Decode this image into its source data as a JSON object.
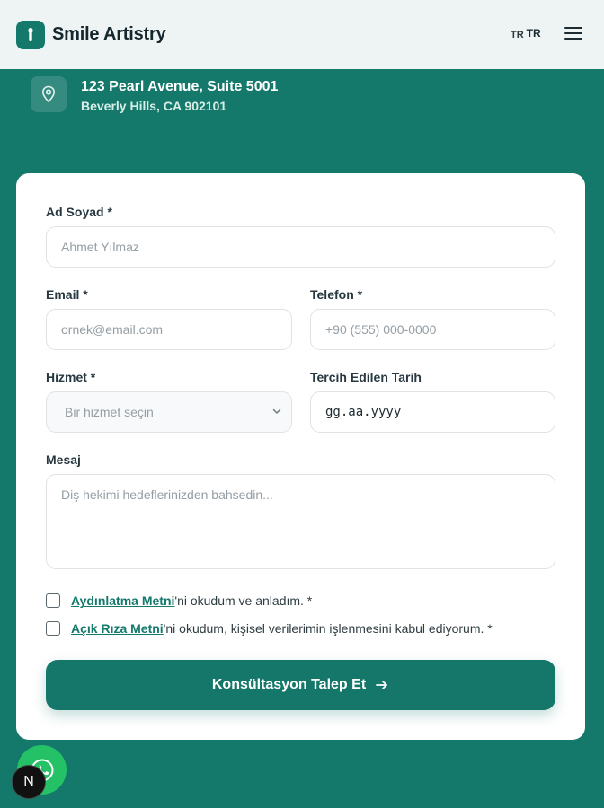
{
  "header": {
    "brand": "Smile Artistry",
    "lang_small": "TR",
    "lang_big": "TR"
  },
  "address": {
    "line1": "123 Pearl Avenue, Suite 5001",
    "line2": "Beverly Hills, CA 902101"
  },
  "form": {
    "name_label": "Ad Soyad *",
    "name_placeholder": "Ahmet Yılmaz",
    "email_label": "Email *",
    "email_placeholder": "ornek@email.com",
    "phone_label": "Telefon *",
    "phone_placeholder": "+90 (555) 000-0000",
    "service_label": "Hizmet *",
    "service_selected": "Bir hizmet seçin",
    "date_label": "Tercih Edilen Tarih",
    "date_value": "gg.aa.yyyy",
    "message_label": "Mesaj",
    "message_placeholder": "Diş hekimi hedeflerinizden bahsedin...",
    "consent1_link": "Aydınlatma Metni",
    "consent1_text": "'ni okudum ve anladım. *",
    "consent2_link": "Açık Rıza Metni",
    "consent2_text": "'ni okudum, kişisel verilerimin işlenmesini kabul ediyorum. *",
    "submit_label": "Konsültasyon Talep Et"
  },
  "floating": {
    "n_badge": "N"
  },
  "colors": {
    "primary": "#14796b",
    "header_bg": "#eef4f4",
    "whatsapp": "#25c167"
  },
  "icons": [
    "tooth-logo-icon",
    "hamburger-menu-icon",
    "location-pin-icon",
    "chevron-down-icon",
    "arrow-right-icon",
    "whatsapp-icon"
  ]
}
